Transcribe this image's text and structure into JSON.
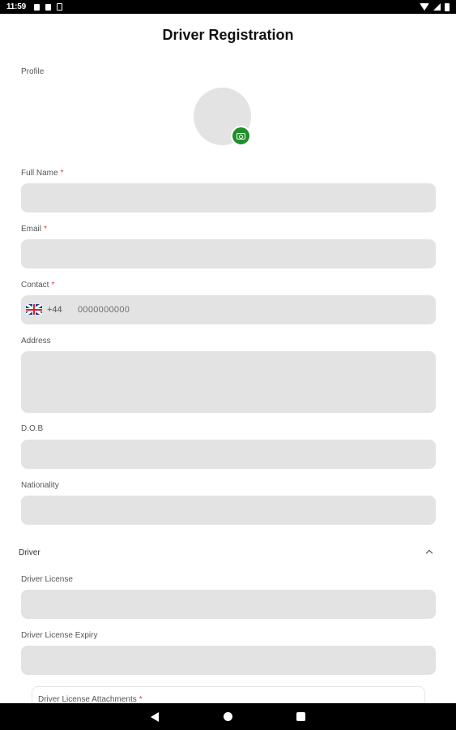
{
  "status_bar": {
    "time": "11:59"
  },
  "header": {
    "title": "Driver Registration"
  },
  "profile": {
    "label": "Profile"
  },
  "form": {
    "full_name": {
      "label": "Full Name",
      "required_mark": "*"
    },
    "email": {
      "label": "Email",
      "required_mark": "*"
    },
    "contact": {
      "label": "Contact",
      "required_mark": "*",
      "dial_code": "+44",
      "placeholder": "0000000000"
    },
    "address": {
      "label": "Address"
    },
    "dob": {
      "label": "D.O.B"
    },
    "nationality": {
      "label": "Nationality"
    }
  },
  "driver_section": {
    "title": "Driver",
    "license": {
      "label": "Driver License"
    },
    "license_expiry": {
      "label": "Driver License Expiry"
    },
    "attachments": {
      "label": "Driver License Attachments",
      "required_mark": "*"
    }
  },
  "icons": {
    "camera": "camera-icon",
    "flag": "uk-flag-icon",
    "chevron": "chevron-up-icon",
    "nav_back": "back-icon",
    "nav_home": "home-icon",
    "nav_recents": "recents-icon"
  },
  "colors": {
    "accent": "#1f8f2a",
    "field_bg": "#e3e3e3",
    "required": "#e23b3b"
  }
}
